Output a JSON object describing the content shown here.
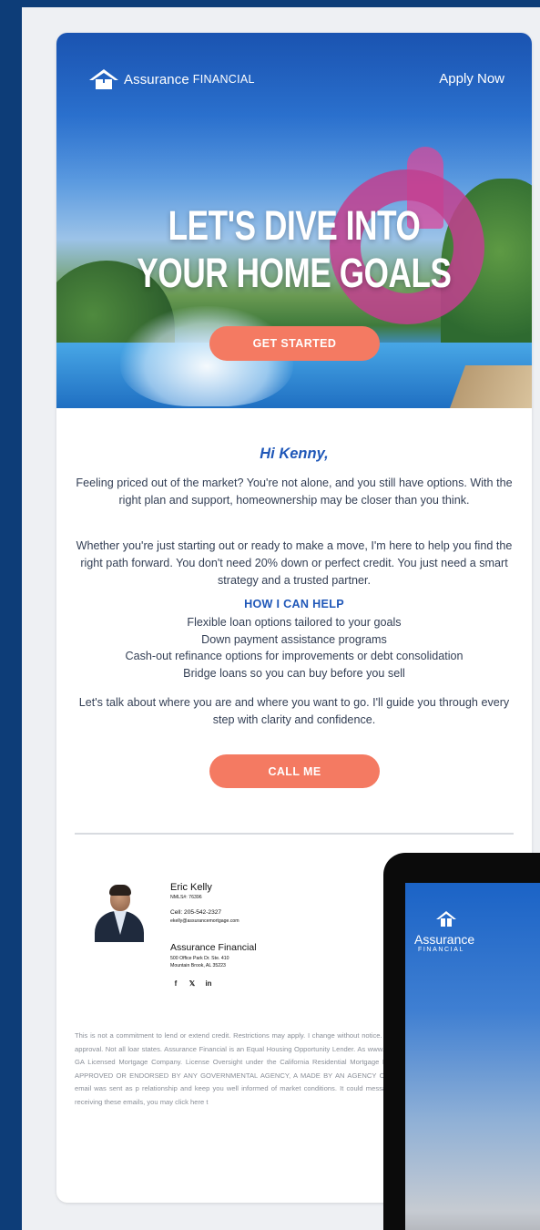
{
  "header": {
    "logo_brand": "Assurance",
    "logo_sub": "FINANCIAL",
    "apply_label": "Apply Now"
  },
  "hero": {
    "headline_line1": "LET'S DIVE INTO",
    "headline_line2": "YOUR HOME GOALS",
    "cta_label": "GET STARTED"
  },
  "body": {
    "greeting": "Hi Kenny,",
    "paragraph1": "Feeling priced out of the market? You're not alone, and you still have options. With the right plan and support, homeownership may be closer than you think.",
    "paragraph2": "Whether you're just starting out or ready to make a move, I'm here to help you find the right path forward. You don't need 20% down or perfect credit. You just need a smart strategy and a trusted partner.",
    "help_heading": "HOW I CAN HELP",
    "help_items": [
      "Flexible loan options tailored to your goals",
      "Down payment assistance programs",
      "Cash-out refinance options for improvements or debt consolidation",
      "Bridge loans so you can buy before you sell"
    ],
    "paragraph3": "Let's talk about where you are and where you want to go. I'll guide you through every step with clarity and confidence.",
    "call_label": "CALL ME"
  },
  "signature": {
    "name": "Eric Kelly",
    "nmls": "NMLS#: 76396",
    "cell": "Cell: 205-542-2327",
    "email": "ekelly@assurancemortgage.com",
    "company": "Assurance Financial",
    "address1": "500 Office Park Dr. Ste. 410",
    "address2": "Mountain Brook, AL 35223",
    "social_icons": [
      "facebook-icon",
      "x-icon",
      "linkedin-icon"
    ]
  },
  "disclaimer": "This is not a commitment to lend or extend credit. Restrictions may apply. I change without notice. All loans are subject to credit approval. Not all loar states. Assurance Financial is an Equal Housing Opportunity Lender. As www.nmlsconsumeraccess.org MS GA Licensed Mortgage Company. License Oversight under the California Residential Mortgage Lending Act. THIS PF BEEN APPROVED OR ENDORSED BY ANY GOVERNMENTAL AGENCY, A MADE BY AN AGENCY OF THE GOVERNMENT. This email was sent as p relationship and keep you well informed of market conditions. It could message. If you would like to stop receiving these emails, you may click here t",
  "tablet": {
    "logo_brand": "Assurance",
    "logo_sub": "FINANCIAL"
  },
  "colors": {
    "background": "#0d3d78",
    "brand_blue": "#1f57b8",
    "button_coral": "#f47a62",
    "text": "#333f55"
  }
}
